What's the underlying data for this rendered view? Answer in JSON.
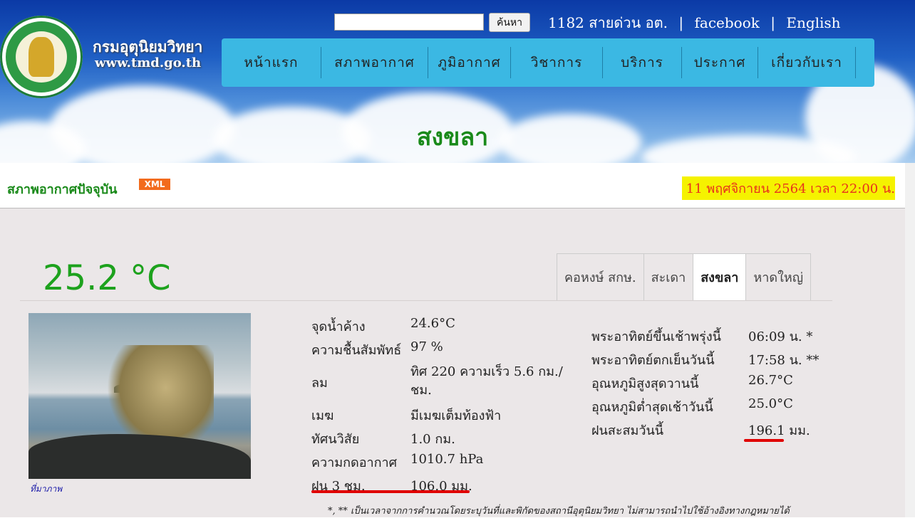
{
  "header": {
    "brand_thai": "กรมอุตุนิยมวิทยา",
    "brand_url": "www.tmd.go.th",
    "search_button": "ค้นหา",
    "hotline": "1182 สายด่วน อต.",
    "separator": "|",
    "facebook": "facebook",
    "english": "English"
  },
  "menu": [
    "หน้าแรก",
    "สภาพอากาศ",
    "ภูมิอากาศ",
    "วิชาการ",
    "บริการ",
    "ประกาศ",
    "เกี่ยวกับเรา"
  ],
  "page_title": "สงขลา",
  "current": {
    "title": "สภาพอากาศปัจจุบัน",
    "xml_badge": "XML",
    "datetime": "11 พฤศจิกายน 2564 เวลา 22:00 น."
  },
  "temperature": "25.2 °C",
  "tabs": [
    "คอหงษ์ สกษ.",
    "สะเดา",
    "สงขลา",
    "หาดใหญ่"
  ],
  "active_tab": "สงขลา",
  "photo_credit": "ที่มาภาพ",
  "observations": [
    {
      "label": "จุดน้ำค้าง",
      "value": "24.6°C"
    },
    {
      "label": "ความชื้นสัมพัทธ์",
      "value": "97 %"
    },
    {
      "label": "ลม",
      "value": "ทิศ 220 ความเร็ว 5.6 กม./ชม."
    },
    {
      "label": "เมฆ",
      "value": "มีเมฆเต็มท้องฟ้า"
    },
    {
      "label": "ทัศนวิสัย",
      "value": "1.0 กม."
    },
    {
      "label": "ความกดอากาศ",
      "value": "1010.7 hPa"
    },
    {
      "label": "ฝน 3 ชม.",
      "value": "106.0 มม."
    }
  ],
  "sun_stats": [
    {
      "label": "พระอาทิตย์ขึ้นเช้าพรุ่งนี้",
      "value": "06:09 น. *"
    },
    {
      "label": "พระอาทิตย์ตกเย็นวันนี้",
      "value": "17:58 น. **"
    },
    {
      "label": "อุณหภูมิสูงสุดวานนี้",
      "value": "26.7°C"
    },
    {
      "label": "อุณหภูมิต่ำสุดเช้าวันนี้",
      "value": "25.0°C"
    },
    {
      "label": "ฝนสะสมวันนี้",
      "value": "196.1 มม."
    }
  ],
  "footnote": "*, ** เป็นเวลาจากการคำนวณโดยระบุวันที่และพิกัดของสถานีอุตุนิยมวิทยา ไม่สามารถนำไปใช้อ้างอิงทางกฎหมายได้"
}
